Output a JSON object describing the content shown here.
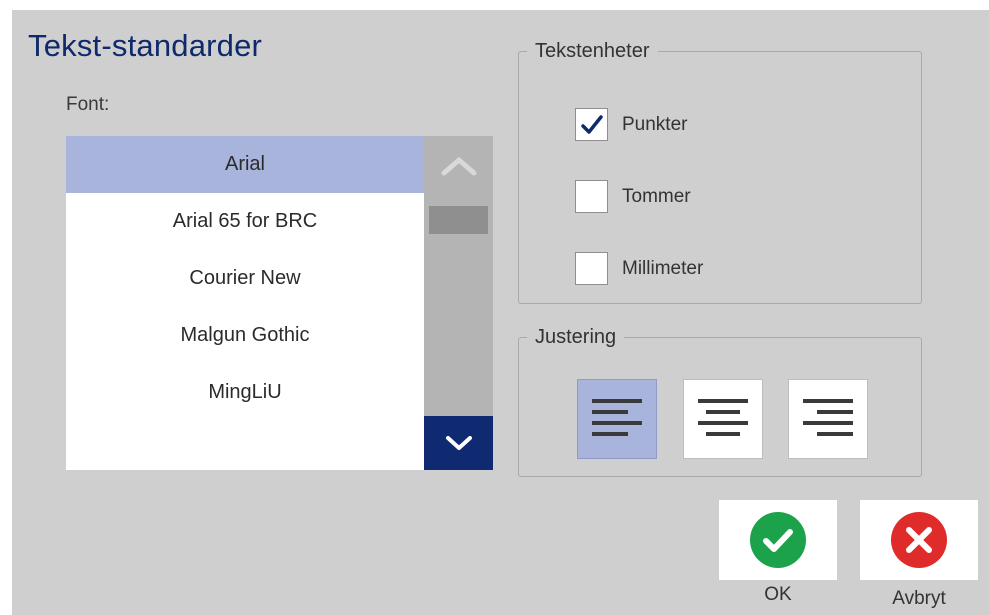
{
  "dialog": {
    "title": "Tekst-standarder",
    "font_label": "Font:",
    "fonts": [
      "Arial",
      "Arial 65 for BRC",
      "Courier New",
      "Malgun Gothic",
      "MingLiU"
    ],
    "selected_font": "Arial",
    "scrollbar": {
      "up_icon": "chevron-up-icon",
      "down_icon": "chevron-down-icon"
    }
  },
  "units": {
    "legend": "Tekstenheter",
    "options": [
      {
        "label": "Punkter",
        "checked": true
      },
      {
        "label": "Tommer",
        "checked": false
      },
      {
        "label": "Millimeter",
        "checked": false
      }
    ]
  },
  "alignment": {
    "legend": "Justering",
    "options": [
      {
        "icon": "align-left-icon",
        "active": true
      },
      {
        "icon": "align-center-icon",
        "active": false
      },
      {
        "icon": "align-right-icon",
        "active": false
      }
    ]
  },
  "actions": {
    "ok_label": "OK",
    "cancel_label": "Avbryt",
    "ok_icon": "check-circle-icon",
    "cancel_icon": "x-circle-icon"
  },
  "colors": {
    "title": "#0e2a6b",
    "selection": "#a8b4db",
    "scroll_down": "#102a72",
    "ok_green": "#1ca24a",
    "cancel_red": "#e02b2b"
  }
}
